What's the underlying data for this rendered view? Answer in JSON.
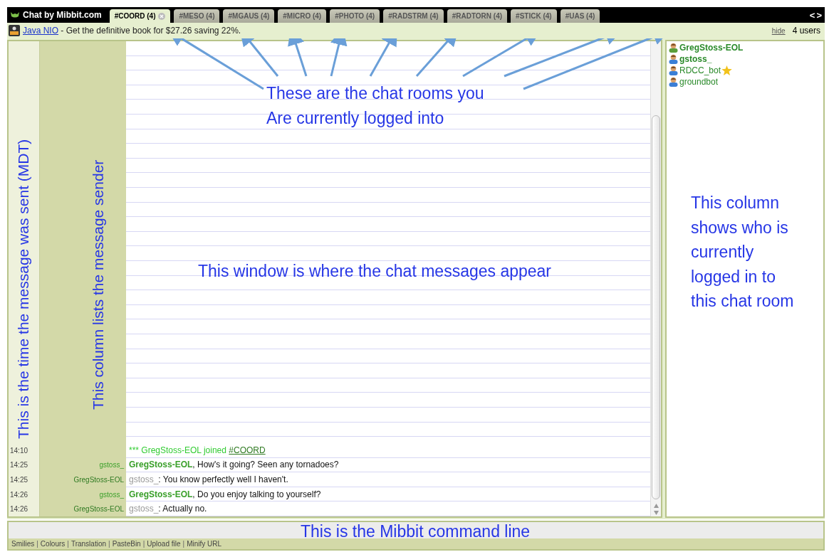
{
  "brand": "Chat by Mibbit.com",
  "tabs": [
    {
      "label": "#COORD (4)",
      "selected": true
    },
    {
      "label": "#MESO (4)",
      "selected": false
    },
    {
      "label": "#MGAUS (4)",
      "selected": false
    },
    {
      "label": "#MICRO (4)",
      "selected": false
    },
    {
      "label": "#PHOTO (4)",
      "selected": false
    },
    {
      "label": "#RADSTRM (4)",
      "selected": false
    },
    {
      "label": "#RADTORN (4)",
      "selected": false
    },
    {
      "label": "#STICK (4)",
      "selected": false
    },
    {
      "label": "#UAS (4)",
      "selected": false
    }
  ],
  "tab_scroll": [
    "<",
    ">"
  ],
  "ad": {
    "link": "Java NIO",
    "text": " - Get the definitive book for $27.26 saving 22%."
  },
  "hide_link": "hide",
  "user_count": "4 users",
  "messages": [
    {
      "kind": "join",
      "time": "14:10",
      "text": "*** GregStoss-EOL joined",
      "link": "#COORD"
    },
    {
      "kind": "message",
      "time": "14:25",
      "sender": "gstoss_",
      "highlight": true,
      "mention": "GregStoss-EOL",
      "text": ", How's it going? Seen any tornadoes?"
    },
    {
      "kind": "message",
      "time": "14:25",
      "sender": "GregStoss-EOL",
      "highlight": false,
      "mention": "gstoss_",
      "text": ": You know perfectly well I haven't."
    },
    {
      "kind": "message",
      "time": "14:26",
      "sender": "gstoss_",
      "highlight": true,
      "mention": "GregStoss-EOL",
      "text": ", Do you enjoy talking to yourself?"
    },
    {
      "kind": "message",
      "time": "14:26",
      "sender": "GregStoss-EOL",
      "highlight": false,
      "mention": "gstoss_",
      "text": ": Actually no."
    }
  ],
  "users": [
    {
      "name": "GregStoss-EOL",
      "kind": "op",
      "bold": true,
      "starred": false
    },
    {
      "name": "gstoss_",
      "kind": "user",
      "bold": true,
      "starred": false
    },
    {
      "name": "RDCC_bot",
      "kind": "user",
      "bold": false,
      "starred": true
    },
    {
      "name": "groundbot",
      "kind": "user",
      "bold": false,
      "starred": false
    }
  ],
  "footer_links": [
    "Smilies",
    "Colours",
    "Translation",
    "PasteBin",
    "Upload file",
    "Minify URL"
  ],
  "footer_separator": "|",
  "annotations": [
    {
      "kind": "horizontal",
      "text": "These are the chat rooms you\nAre currently logged into"
    },
    {
      "kind": "horizontal",
      "text": "This window is where the chat messages appear"
    },
    {
      "kind": "horizontal",
      "text": "This column\nshows who is\ncurrently\nlogged in to\nthis chat room"
    },
    {
      "kind": "vertical",
      "text": "This is the time the message was sent (MDT)"
    },
    {
      "kind": "vertical",
      "text": "This column lists the message sender"
    },
    {
      "kind": "horizontal",
      "text": "This is the Mibbit command line"
    }
  ]
}
